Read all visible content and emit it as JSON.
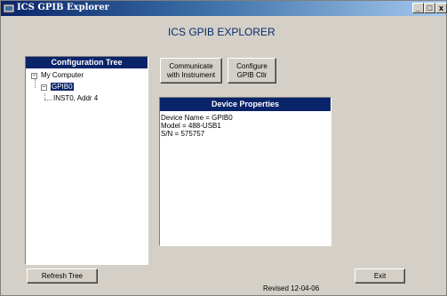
{
  "window": {
    "title": "ICS GPIB Explorer",
    "controls": {
      "minimize": "_",
      "maximize": "□",
      "close": "x"
    }
  },
  "heading": "ICS GPIB EXPLORER",
  "config_tree": {
    "header": "Configuration Tree",
    "nodes": [
      {
        "label": "My Computer",
        "expander": "−"
      },
      {
        "label": "GPIB0",
        "expander": "−",
        "selected": true
      },
      {
        "label": "INST0, Addr  4"
      }
    ]
  },
  "buttons": {
    "communicate": "Communicate\nwith Instrument",
    "configure": "Configure\nGPIB Ctlr",
    "refresh": "Refresh Tree",
    "exit": "Exit"
  },
  "device_properties": {
    "header": "Device Properties",
    "lines": [
      "Device Name = GPIB0",
      "Model = 488-USB1",
      "S/N = 575757"
    ]
  },
  "footer": {
    "revised": "Revised 12-04-06"
  },
  "colors": {
    "title_active": "#0a246a",
    "heading": "#0a2c6b",
    "face": "#d4d0c8"
  }
}
